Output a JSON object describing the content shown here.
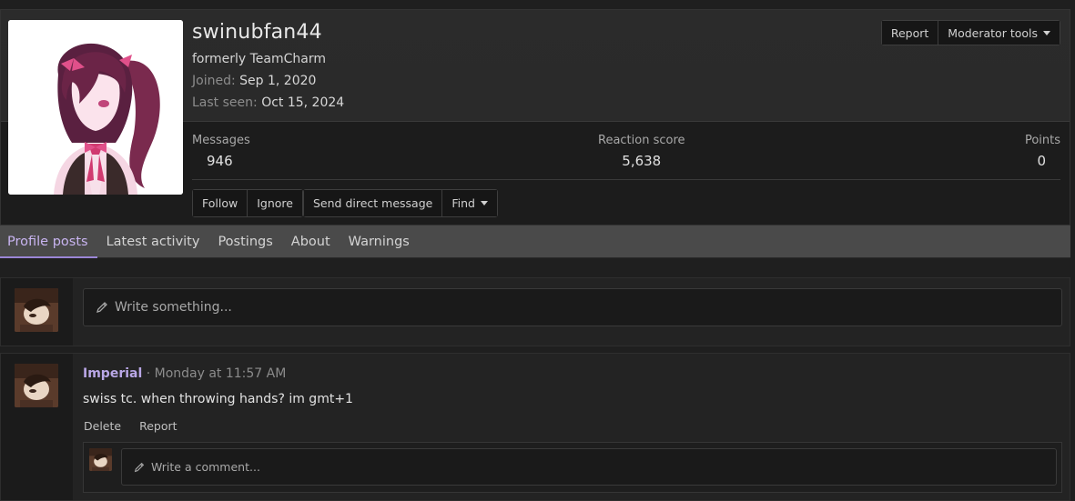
{
  "profile": {
    "username": "swinubfan44",
    "user_title": "formerly TeamCharm",
    "joined_label": "Joined:",
    "joined_value": "Sep 1, 2020",
    "last_seen_label": "Last seen:",
    "last_seen_value": "Oct 15, 2024",
    "avatar_icon": "avatar-anime-girl-pink"
  },
  "top_actions": {
    "report_label": "Report",
    "moderator_tools_label": "Moderator tools"
  },
  "stats": {
    "messages_label": "Messages",
    "messages_value": "946",
    "reaction_label": "Reaction score",
    "reaction_value": "5,638",
    "points_label": "Points",
    "points_value": "0"
  },
  "profile_actions": {
    "follow_label": "Follow",
    "ignore_label": "Ignore",
    "dm_label": "Send direct message",
    "find_label": "Find"
  },
  "tabs": [
    {
      "label": "Profile posts",
      "active": true
    },
    {
      "label": "Latest activity",
      "active": false
    },
    {
      "label": "Postings",
      "active": false
    },
    {
      "label": "About",
      "active": false
    },
    {
      "label": "Warnings",
      "active": false
    }
  ],
  "composer": {
    "placeholder": "Write something..."
  },
  "post": {
    "author": "Imperial",
    "time": "· Monday at 11:57 AM",
    "body": "swiss tc. when throwing hands? im gmt+1",
    "delete_label": "Delete",
    "report_label": "Report",
    "comment_placeholder": "Write a comment..."
  },
  "colors": {
    "accent": "#9a86d6",
    "author_link": "#b9a7e6",
    "background": "#1f1f1f",
    "tab_bar": "#4a4a4a"
  }
}
